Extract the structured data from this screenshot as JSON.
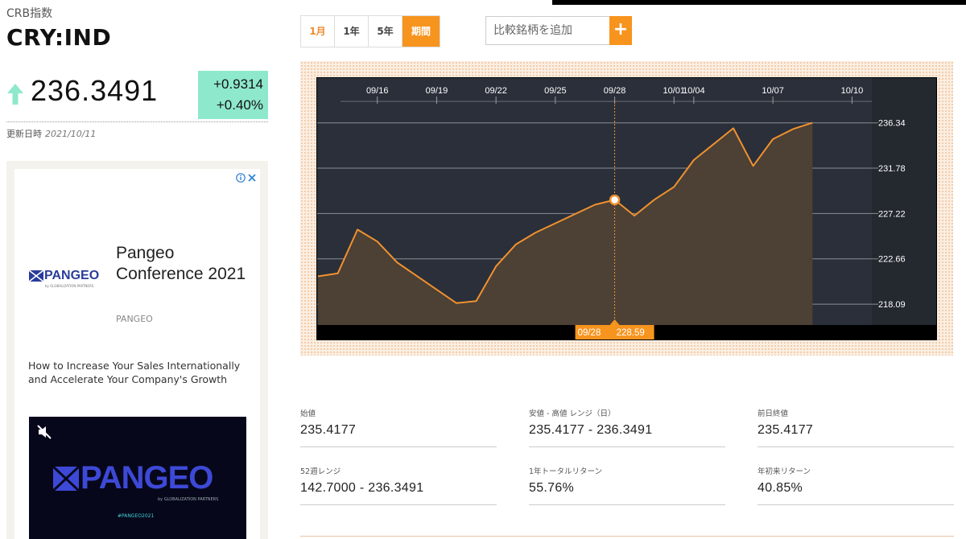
{
  "header": {
    "index_name": "CRB指数",
    "ticker": "CRY:IND",
    "price": "236.3491",
    "change_abs": "+0.9314",
    "change_pct": "+0.40%",
    "updated_label": "更新日時",
    "updated_date": "2021/10/11",
    "up_color": "#8ee8cc"
  },
  "range_tabs": [
    {
      "label": "1月",
      "state": "highlighted"
    },
    {
      "label": "1年",
      "state": "normal"
    },
    {
      "label": "5年",
      "state": "normal"
    },
    {
      "label": "期間",
      "state": "selected"
    }
  ],
  "compare": {
    "placeholder": "比較銘柄を追加",
    "add_label": "+"
  },
  "colors": {
    "accent": "#f7941e",
    "chart_bg": "#2a2f3a",
    "area_fill": "#4d4035",
    "line": "#f0922e"
  },
  "chart_data": {
    "type": "area",
    "x_tick_labels": [
      "09/16",
      "09/19",
      "09/22",
      "09/25",
      "09/28",
      "10/01",
      "10/04",
      "10/07",
      "10/10"
    ],
    "y_tick_labels": [
      "236.34",
      "231.78",
      "227.22",
      "222.66",
      "218.09"
    ],
    "ylim": [
      216.0,
      238.5
    ],
    "x_range": [
      0,
      28
    ],
    "x": [
      0,
      1,
      2,
      3,
      4,
      7,
      8,
      9,
      10,
      11,
      14,
      15,
      16,
      17,
      18,
      19,
      21,
      22,
      23,
      24,
      25
    ],
    "dates": [
      "09/13",
      "09/14",
      "09/15",
      "09/16",
      "09/17",
      "09/20",
      "09/21",
      "09/22",
      "09/23",
      "09/24",
      "09/27",
      "09/28",
      "09/29",
      "09/30",
      "10/01",
      "10/04",
      "10/05",
      "10/06",
      "10/07",
      "10/08",
      "10/11"
    ],
    "values": [
      220.9,
      221.2,
      225.6,
      224.4,
      222.3,
      218.2,
      218.4,
      221.9,
      224.1,
      225.3,
      228.1,
      228.59,
      227.0,
      228.6,
      229.9,
      232.6,
      235.8,
      232.0,
      234.7,
      235.7,
      236.35
    ],
    "crosshair": {
      "date": "09/28",
      "value": "228.59"
    },
    "grid": true
  },
  "stats": [
    {
      "label": "始値",
      "value": "235.4177"
    },
    {
      "label": "安値 - 高値 レンジ（日）",
      "value": "235.4177 - 236.3491"
    },
    {
      "label": "前日終値",
      "value": "235.4177"
    },
    {
      "label": "52週レンジ",
      "value": "142.7000 - 236.3491"
    },
    {
      "label": "1年トータルリターン",
      "value": "55.76%"
    },
    {
      "label": "年初来リターン",
      "value": "40.85%"
    }
  ],
  "ad": {
    "choices_icon": "ad-choices-icon",
    "logo_text": "PANGEO",
    "logo_sub": "by GLOBALIZATION PARTNERS",
    "title": "Pangeo Conference 2021",
    "brand": "PANGEO",
    "description": "How to Increase Your Sales Internationally and Accelerate Your Company's Growth",
    "video_logo": "PANGEO",
    "video_sub": "by GLOBALIZATION PARTNERS",
    "video_hashtag": "#PANGEO2021"
  }
}
